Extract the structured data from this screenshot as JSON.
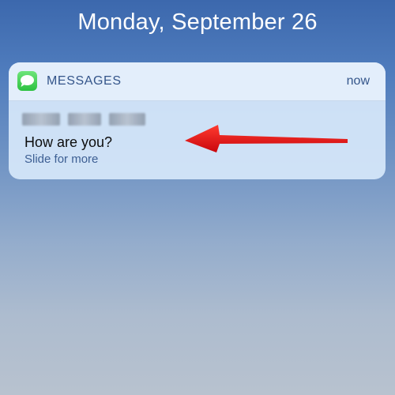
{
  "lockscreen": {
    "date": "Monday, September 26"
  },
  "notification": {
    "app_icon": "messages-bubble-icon",
    "app_name": "MESSAGES",
    "time": "now",
    "sender_blurred": true,
    "message": "How are you?",
    "hint": "Slide for more"
  },
  "annotation": {
    "arrow_color": "#e8141b"
  },
  "colors": {
    "header_text": "#34558a",
    "messages_green": "#2cc140"
  }
}
